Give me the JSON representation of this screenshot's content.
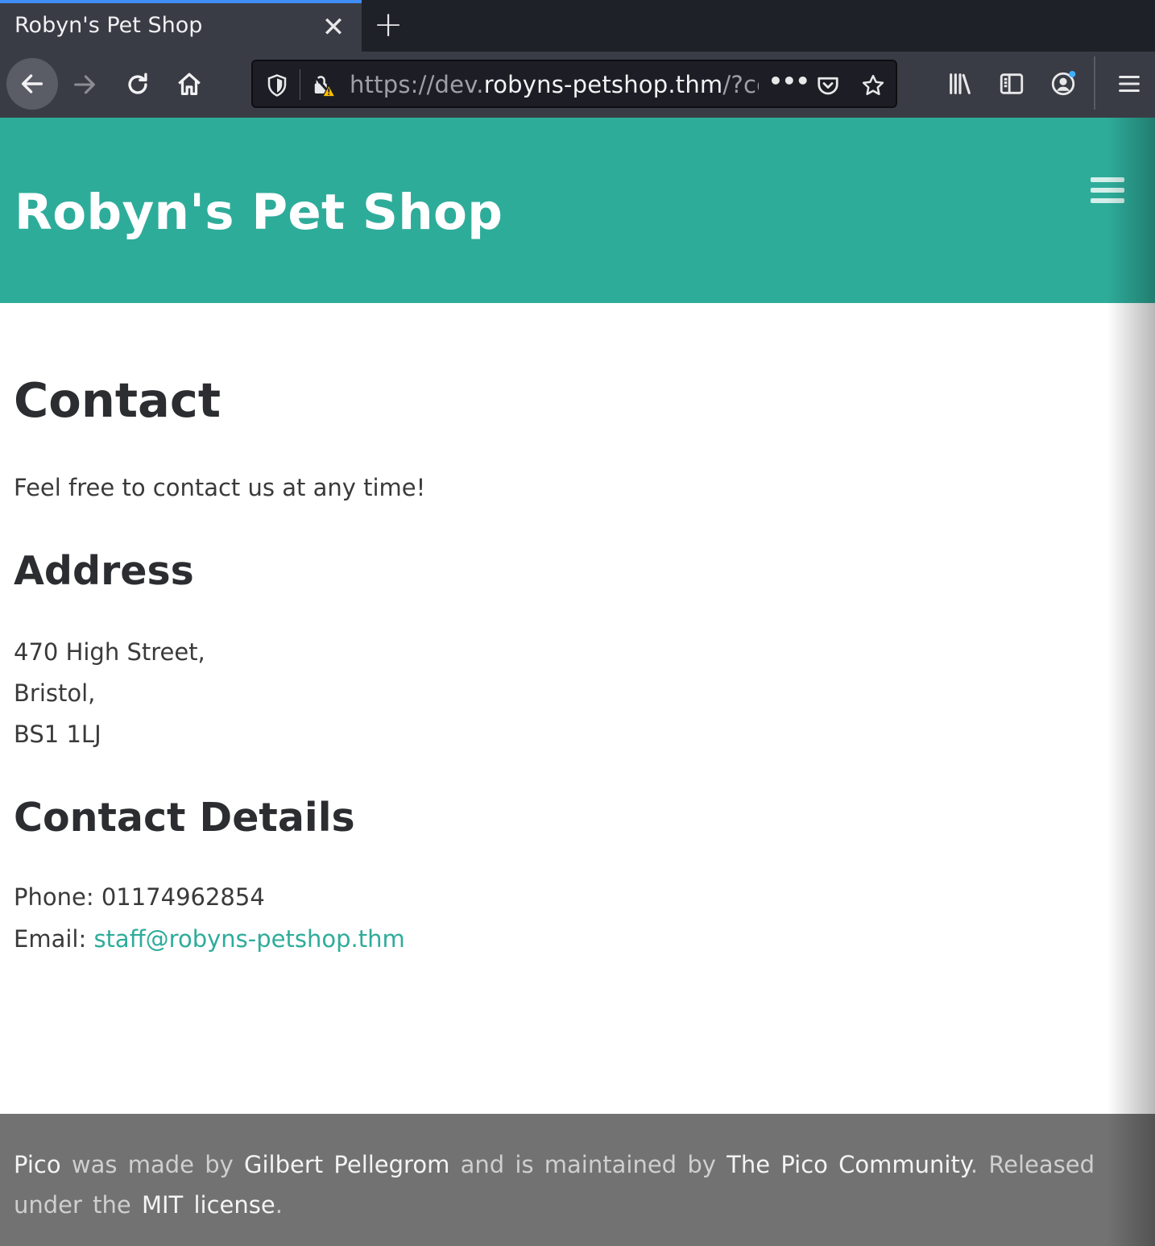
{
  "browser": {
    "tab_title": "Robyn's Pet Shop",
    "tab_close": "✕",
    "new_tab": "+",
    "url_prefix": "https://dev.",
    "url_host": "robyns-petshop.thm",
    "url_suffix": "/?cor",
    "url_more": "•••",
    "icons": [
      "back-arrow-icon",
      "forward-arrow-icon",
      "reload-icon",
      "home-icon",
      "tracking-protection-shield-icon",
      "insecure-lock-warning-icon",
      "pocket-icon",
      "bookmark-star-icon",
      "library-icon",
      "sidebar-icon",
      "account-icon",
      "menu-icon"
    ],
    "accent_color": "#3f8ef6"
  },
  "site": {
    "title": "Robyn's Pet Shop",
    "brand_color": "#2eac9a",
    "menu_icon": "hamburger-menu-icon"
  },
  "content": {
    "heading": "Contact",
    "intro": "Feel free to contact us at any time!",
    "address_heading": "Address",
    "address_lines": [
      "470 High Street,",
      "Bristol,",
      "BS1 1LJ"
    ],
    "details_heading": "Contact Details",
    "phone_label": "Phone: 01174962854",
    "email_label": "Email: ",
    "email_value": "staff@robyns-petshop.thm"
  },
  "footer": {
    "pico": "Pico",
    "made_by": "was made by",
    "author": "Gilbert Pellegrom",
    "maintained": "and is maintained by",
    "community": "The Pico Community",
    "released": ". Released under the",
    "license": "MIT license",
    "end": "."
  }
}
